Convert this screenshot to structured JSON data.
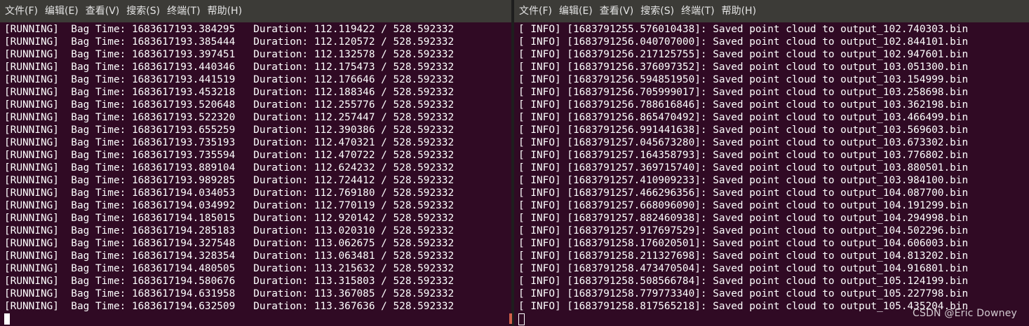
{
  "left_terminal": {
    "menu": [
      "文件(F)",
      "编辑(E)",
      "查看(V)",
      "搜索(S)",
      "终端(T)",
      "帮助(H)"
    ],
    "lines": [
      "[RUNNING]  Bag Time: 1683617193.384295   Duration: 112.119422 / 528.592332",
      "[RUNNING]  Bag Time: 1683617193.385444   Duration: 112.120572 / 528.592332",
      "[RUNNING]  Bag Time: 1683617193.397451   Duration: 112.132578 / 528.592332",
      "[RUNNING]  Bag Time: 1683617193.440346   Duration: 112.175473 / 528.592332",
      "[RUNNING]  Bag Time: 1683617193.441519   Duration: 112.176646 / 528.592332",
      "[RUNNING]  Bag Time: 1683617193.453218   Duration: 112.188346 / 528.592332",
      "[RUNNING]  Bag Time: 1683617193.520648   Duration: 112.255776 / 528.592332",
      "[RUNNING]  Bag Time: 1683617193.522320   Duration: 112.257447 / 528.592332",
      "[RUNNING]  Bag Time: 1683617193.655259   Duration: 112.390386 / 528.592332",
      "[RUNNING]  Bag Time: 1683617193.735193   Duration: 112.470321 / 528.592332",
      "[RUNNING]  Bag Time: 1683617193.735594   Duration: 112.470722 / 528.592332",
      "[RUNNING]  Bag Time: 1683617193.889104   Duration: 112.624232 / 528.592332",
      "[RUNNING]  Bag Time: 1683617193.989285   Duration: 112.724412 / 528.592332",
      "[RUNNING]  Bag Time: 1683617194.034053   Duration: 112.769180 / 528.592332",
      "[RUNNING]  Bag Time: 1683617194.034992   Duration: 112.770119 / 528.592332",
      "[RUNNING]  Bag Time: 1683617194.185015   Duration: 112.920142 / 528.592332",
      "[RUNNING]  Bag Time: 1683617194.285183   Duration: 113.020310 / 528.592332",
      "[RUNNING]  Bag Time: 1683617194.327548   Duration: 113.062675 / 528.592332",
      "[RUNNING]  Bag Time: 1683617194.328354   Duration: 113.063481 / 528.592332",
      "[RUNNING]  Bag Time: 1683617194.480505   Duration: 113.215632 / 528.592332",
      "[RUNNING]  Bag Time: 1683617194.580676   Duration: 113.315803 / 528.592332",
      "[RUNNING]  Bag Time: 1683617194.631958   Duration: 113.367085 / 528.592332",
      "[RUNNING]  Bag Time: 1683617194.632509   Duration: 113.367636 / 528.592332"
    ]
  },
  "right_terminal": {
    "menu": [
      "文件(F)",
      "编辑(E)",
      "查看(V)",
      "搜索(S)",
      "终端(T)",
      "帮助(H)"
    ],
    "lines": [
      "[ INFO] [1683791255.576010438]: Saved point cloud to output_102.740303.bin",
      "[ INFO] [1683791256.040707000]: Saved point cloud to output_102.844101.bin",
      "[ INFO] [1683791256.217125755]: Saved point cloud to output_102.947601.bin",
      "[ INFO] [1683791256.376097352]: Saved point cloud to output_103.051300.bin",
      "[ INFO] [1683791256.594851950]: Saved point cloud to output_103.154999.bin",
      "[ INFO] [1683791256.705999017]: Saved point cloud to output_103.258698.bin",
      "[ INFO] [1683791256.788616846]: Saved point cloud to output_103.362198.bin",
      "[ INFO] [1683791256.865470492]: Saved point cloud to output_103.466499.bin",
      "[ INFO] [1683791256.991441638]: Saved point cloud to output_103.569603.bin",
      "[ INFO] [1683791257.045673280]: Saved point cloud to output_103.673302.bin",
      "[ INFO] [1683791257.164358793]: Saved point cloud to output_103.776802.bin",
      "[ INFO] [1683791257.369715740]: Saved point cloud to output_103.880501.bin",
      "[ INFO] [1683791257.410909233]: Saved point cloud to output_103.984100.bin",
      "[ INFO] [1683791257.466296356]: Saved point cloud to output_104.087700.bin",
      "[ INFO] [1683791257.668096090]: Saved point cloud to output_104.191299.bin",
      "[ INFO] [1683791257.882460938]: Saved point cloud to output_104.294998.bin",
      "[ INFO] [1683791257.917697529]: Saved point cloud to output_104.502296.bin",
      "[ INFO] [1683791258.176020501]: Saved point cloud to output_104.606003.bin",
      "[ INFO] [1683791258.211327698]: Saved point cloud to output_104.813202.bin",
      "[ INFO] [1683791258.473470504]: Saved point cloud to output_104.916801.bin",
      "[ INFO] [1683791258.508566784]: Saved point cloud to output_105.124199.bin",
      "[ INFO] [1683791258.779773340]: Saved point cloud to output_105.227798.bin",
      "[ INFO] [1683791258.817565218]: Saved point cloud to output_105.435204.bin"
    ]
  },
  "watermark": "CSDN @Eric Downey",
  "colors": {
    "terminal_bg": "#300a24",
    "menubar_bg": "#3c3b37",
    "text": "#ffffff"
  }
}
